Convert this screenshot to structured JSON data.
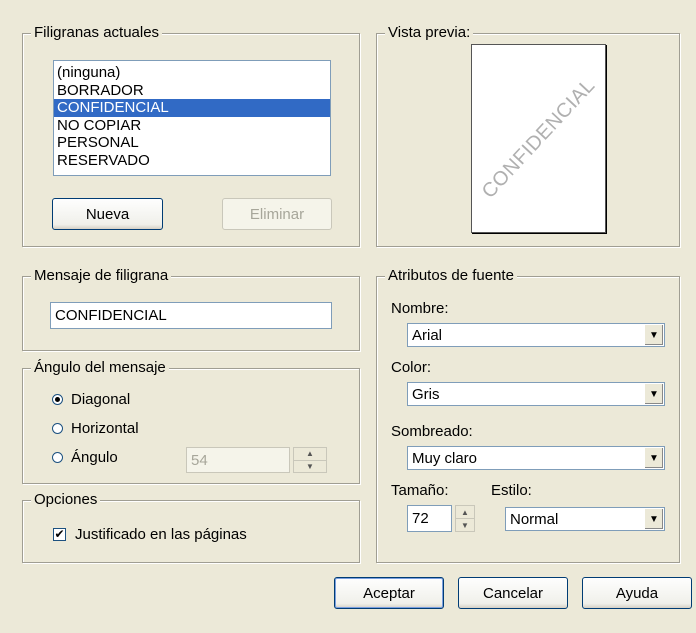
{
  "current_watermarks": {
    "title": "Filigranas actuales",
    "items": [
      "(ninguna)",
      "BORRADOR",
      "CONFIDENCIAL",
      "NO COPIAR",
      "PERSONAL",
      "RESERVADO"
    ],
    "selected_index": 2,
    "new_button": "Nueva",
    "delete_button": "Eliminar"
  },
  "preview": {
    "title": "Vista previa:",
    "watermark_text": "CONFIDENCIAL"
  },
  "message": {
    "title": "Mensaje de filigrana",
    "value": "CONFIDENCIAL"
  },
  "angle": {
    "title": "Ángulo del mensaje",
    "options": [
      "Diagonal",
      "Horizontal",
      "Ángulo"
    ],
    "selected": "Diagonal",
    "angle_value": "54"
  },
  "options": {
    "title": "Opciones",
    "fit_pages_label": "Justificado en las páginas",
    "fit_pages_checked": true
  },
  "font": {
    "title": "Atributos de fuente",
    "name_label": "Nombre:",
    "name_value": "Arial",
    "color_label": "Color:",
    "color_value": "Gris",
    "shading_label": "Sombreado:",
    "shading_value": "Muy claro",
    "size_label": "Tamaño:",
    "size_value": "72",
    "style_label": "Estilo:",
    "style_value": "Normal"
  },
  "footer": {
    "ok": "Aceptar",
    "cancel": "Cancelar",
    "help": "Ayuda"
  }
}
